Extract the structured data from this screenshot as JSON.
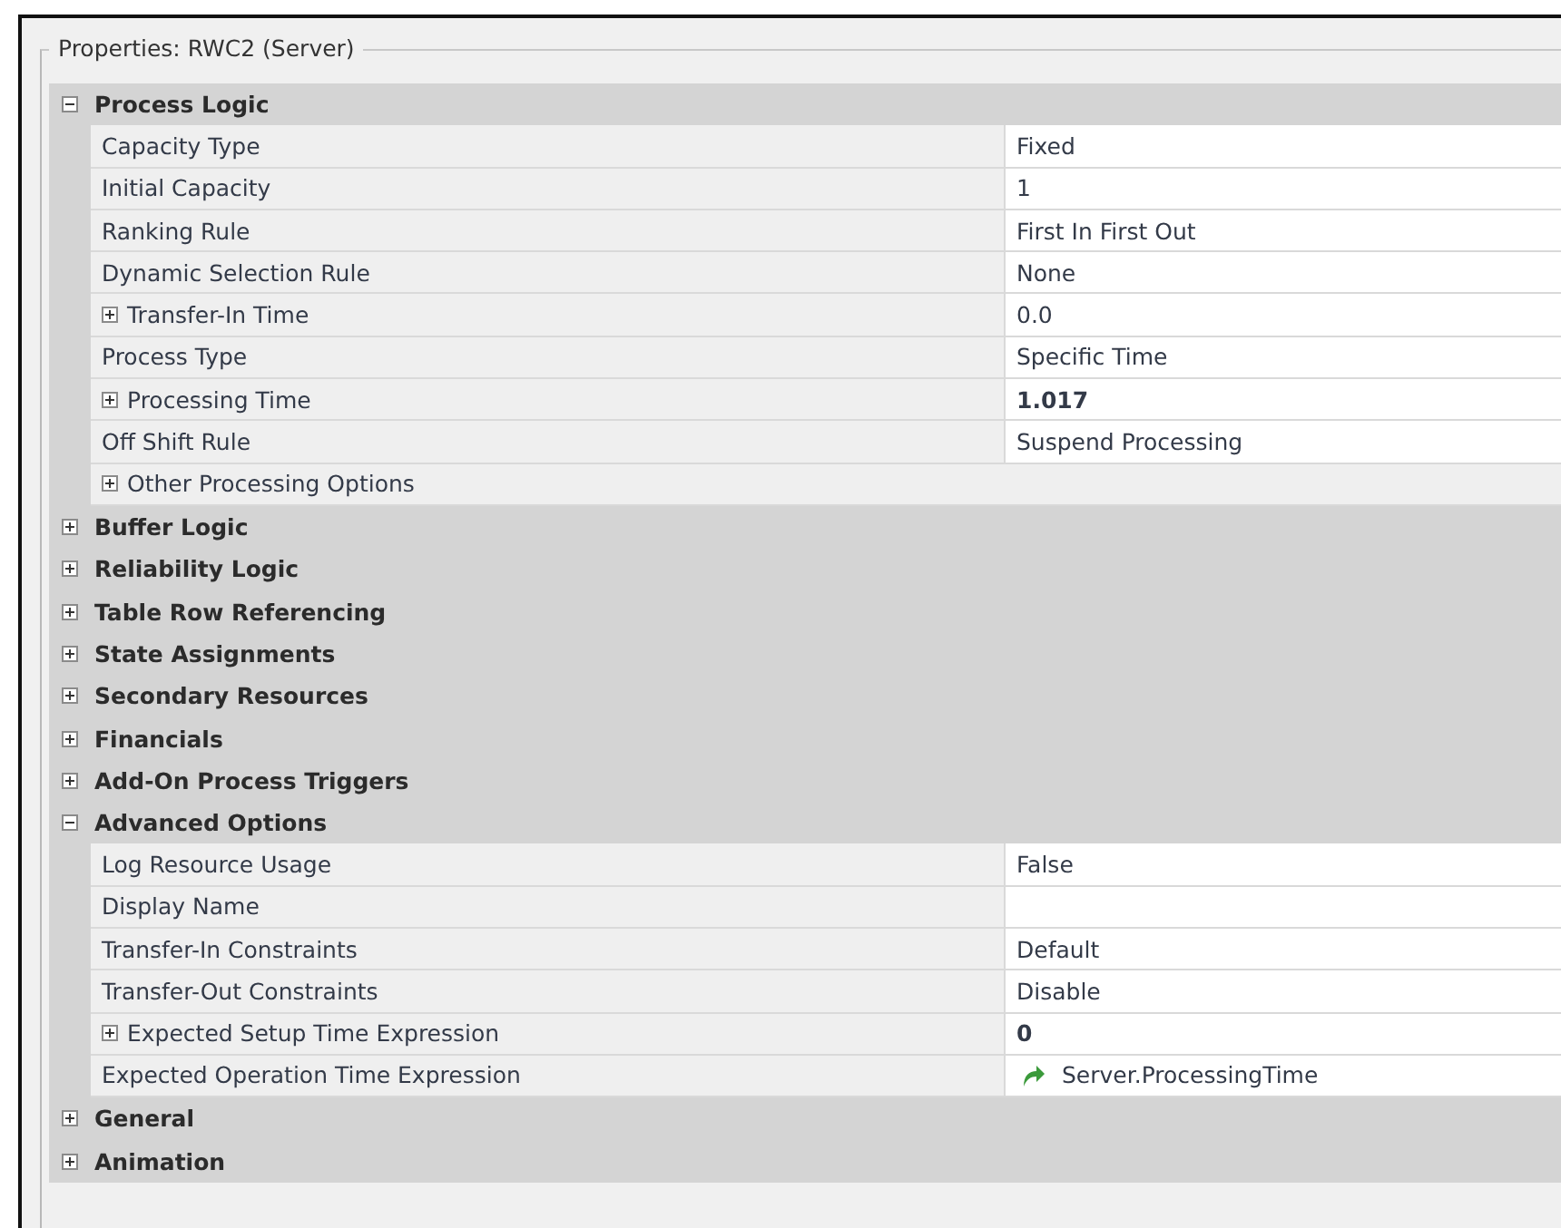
{
  "panel": {
    "title": "Properties: RWC2 (Server)"
  },
  "categories": [
    {
      "label": "Process Logic",
      "expanded": true,
      "properties": [
        {
          "name": "Capacity Type",
          "value": "Fixed"
        },
        {
          "name": "Initial Capacity",
          "value": "1"
        },
        {
          "name": "Ranking Rule",
          "value": "First In First Out"
        },
        {
          "name": "Dynamic Selection Rule",
          "value": "None"
        },
        {
          "name": "Transfer-In Time",
          "value": "0.0",
          "expandable": true
        },
        {
          "name": "Process Type",
          "value": "Specific Time"
        },
        {
          "name": "Processing Time",
          "value": "1.017",
          "expandable": true,
          "modified": true
        },
        {
          "name": "Off Shift Rule",
          "value": "Suspend Processing"
        },
        {
          "name": "Other Processing Options",
          "expandable": true,
          "kind": "group"
        }
      ]
    },
    {
      "label": "Buffer Logic",
      "expanded": false
    },
    {
      "label": "Reliability Logic",
      "expanded": false
    },
    {
      "label": "Table Row Referencing",
      "expanded": false
    },
    {
      "label": "State Assignments",
      "expanded": false
    },
    {
      "label": "Secondary Resources",
      "expanded": false
    },
    {
      "label": "Financials",
      "expanded": false
    },
    {
      "label": "Add-On Process Triggers",
      "expanded": false
    },
    {
      "label": "Advanced Options",
      "expanded": true,
      "properties": [
        {
          "name": "Log Resource Usage",
          "value": "False"
        },
        {
          "name": "Display Name"
        },
        {
          "name": "Transfer-In Constraints",
          "value": "Default"
        },
        {
          "name": "Transfer-Out Constraints",
          "value": "Disable"
        },
        {
          "name": "Expected Setup Time Expression",
          "value": "0",
          "expandable": true,
          "modified": true
        },
        {
          "name": "Expected Operation Time Expression",
          "value": "Server.ProcessingTime",
          "kind": "reference"
        }
      ]
    },
    {
      "label": "General",
      "expanded": false
    },
    {
      "label": "Animation",
      "expanded": false
    }
  ]
}
